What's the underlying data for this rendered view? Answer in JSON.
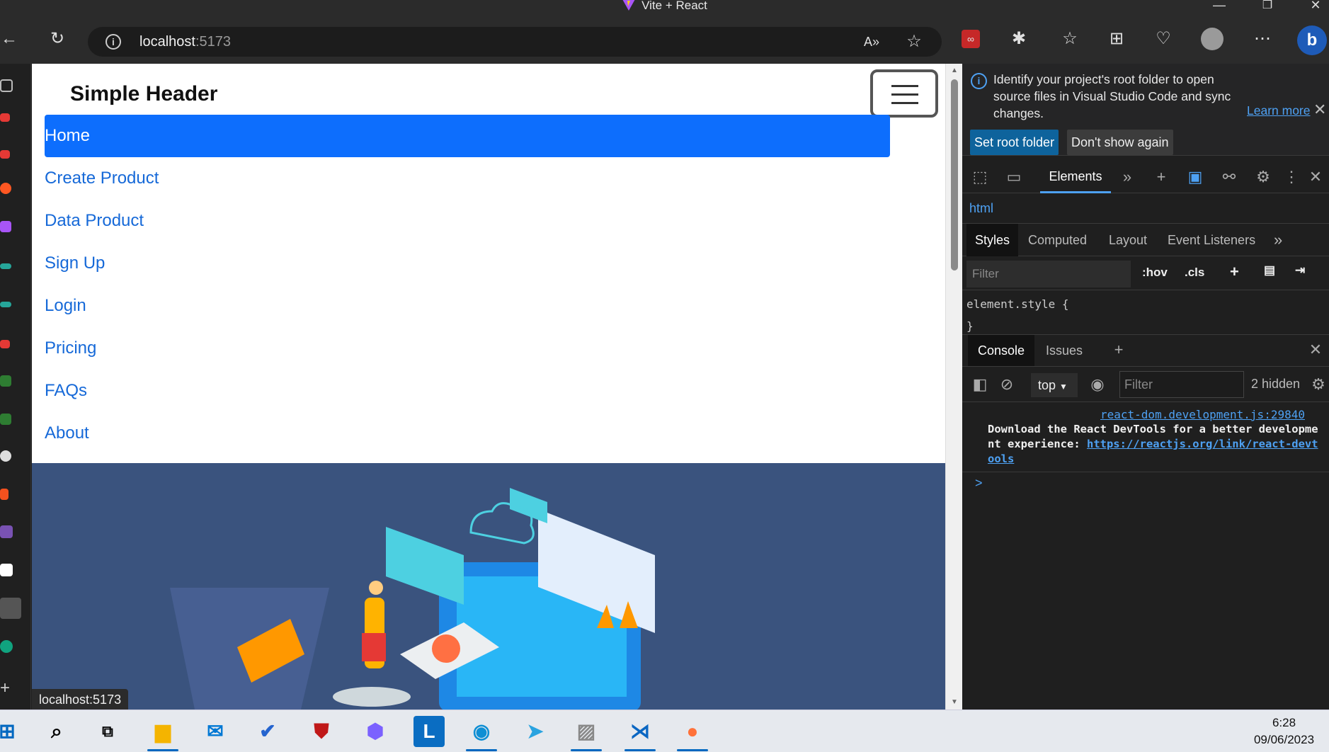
{
  "window": {
    "title": "Vite + React"
  },
  "browser": {
    "url_host": "localhost",
    "url_port": ":5173",
    "status_url": "localhost:5173"
  },
  "page": {
    "brand": "Simple Header",
    "nav": [
      "Home",
      "Create Product",
      "Data Product",
      "Sign Up",
      "Login",
      "Pricing",
      "FAQs",
      "About"
    ],
    "active_nav": "Home",
    "accent": "#0d6efd",
    "link_color": "#1669d8",
    "hero_bg": "#3a537e"
  },
  "devtools": {
    "info_message": "Identify your project's root folder to open source files in Visual Studio Code and sync changes.",
    "learn_more": "Learn more",
    "set_root_folder": "Set root folder",
    "dont_show_again": "Don't show again",
    "tab_elements": "Elements",
    "breadcrumb": "html",
    "subtabs": [
      "Styles",
      "Computed",
      "Layout",
      "Event Listeners"
    ],
    "styles_filter_placeholder": "Filter",
    "hov": ":hov",
    "cls": ".cls",
    "element_style_open": "element.style {",
    "element_style_close": "}",
    "console_tab": "Console",
    "issues_tab": "Issues",
    "context": "top",
    "console_filter_placeholder": "Filter",
    "hidden_count": "2 hidden",
    "source_link": "react-dom.development.js:29840",
    "log_text": "Download the React DevTools for a better development experience: ",
    "log_link": "https://reactjs.org/link/react-devtools",
    "prompt": ">"
  },
  "taskbar": {
    "time": "6:28",
    "date": "09/06/2023"
  }
}
